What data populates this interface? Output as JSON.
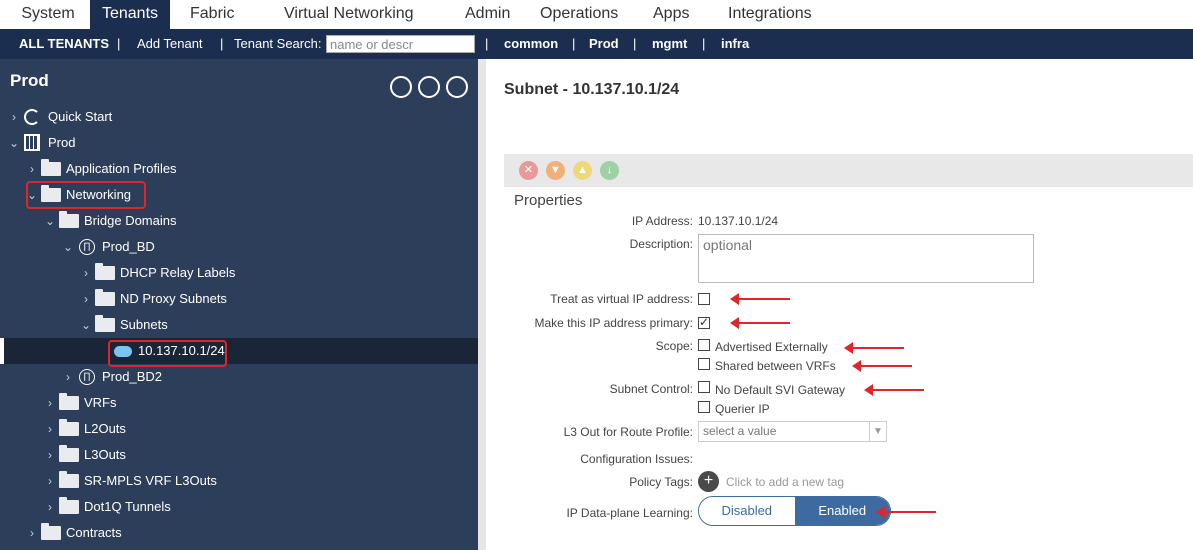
{
  "topnav": {
    "tabs": [
      "System",
      "Tenants",
      "Fabric",
      "Virtual Networking",
      "Admin",
      "Operations",
      "Apps",
      "Integrations"
    ]
  },
  "subnav": {
    "all_tenants": "ALL TENANTS",
    "add_tenant": "Add Tenant",
    "search_label": "Tenant Search:",
    "search_placeholder": "name or descr",
    "tenants": [
      "common",
      "Prod",
      "mgmt",
      "infra"
    ],
    "sep": "|"
  },
  "sidebar": {
    "title": "Prod",
    "items": [
      {
        "label": "Quick Start"
      },
      {
        "label": "Prod"
      },
      {
        "label": "Application Profiles"
      },
      {
        "label": "Networking"
      },
      {
        "label": "Bridge Domains"
      },
      {
        "label": "Prod_BD"
      },
      {
        "label": "DHCP Relay Labels"
      },
      {
        "label": "ND Proxy Subnets"
      },
      {
        "label": "Subnets"
      },
      {
        "label": "10.137.10.1/24"
      },
      {
        "label": "Prod_BD2"
      },
      {
        "label": "VRFs"
      },
      {
        "label": "L2Outs"
      },
      {
        "label": "L3Outs"
      },
      {
        "label": "SR-MPLS VRF L3Outs"
      },
      {
        "label": "Dot1Q Tunnels"
      },
      {
        "label": "Contracts"
      }
    ]
  },
  "content": {
    "title": "Subnet - 10.137.10.1/24",
    "properties_title": "Properties",
    "ip_label": "IP Address:",
    "ip_value": "10.137.10.1/24",
    "desc_label": "Description:",
    "desc_placeholder": "optional",
    "virtual_ip_label": "Treat as virtual IP address:",
    "primary_label": "Make this IP address primary:",
    "scope_label": "Scope:",
    "scope_adv": "Advertised Externally",
    "scope_shared": "Shared between VRFs",
    "subnet_control_label": "Subnet Control:",
    "no_default_svi": "No Default SVI Gateway",
    "querier_ip": "Querier IP",
    "l3out_label": "L3 Out for Route Profile:",
    "l3out_select": "select a value",
    "config_issues_label": "Configuration Issues:",
    "policy_tags_label": "Policy Tags:",
    "policy_tags_hint": "Click to add a new tag",
    "dataplane_label": "IP Data-plane Learning:",
    "disabled": "Disabled",
    "enabled": "Enabled"
  },
  "colors": {
    "nav_bg": "#1c2e4f",
    "sidebar_bg": "#2d3e5a",
    "highlight": "#e0252b",
    "toggle_on": "#3d6aa0"
  }
}
